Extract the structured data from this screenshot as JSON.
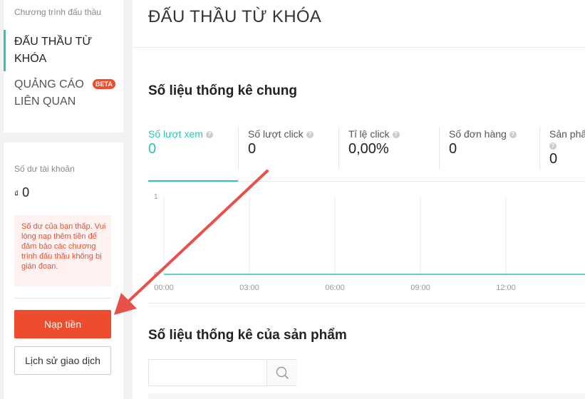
{
  "sidebar": {
    "section_label": "Chương trình đấu thầu",
    "items": [
      {
        "label": "ĐẤU THẦU TỪ KHÓA",
        "active": true
      },
      {
        "label": "QUẢNG CÁO LIÊN QUAN",
        "badge": "BETA"
      }
    ]
  },
  "balance": {
    "label": "Số dư tài khoản",
    "currency": "₫",
    "value": "0",
    "warning": "Số dư của bạn thấp. Vui lòng nạp thêm tiền để đảm bảo các chương trình đấu thầu không bị gián đoạn.",
    "topup_button": "Nạp tiền",
    "history_button": "Lịch sử giao dịch"
  },
  "main": {
    "page_title": "ĐẤU THẦU TỪ KHÓA",
    "stats_title": "Số liệu thống kê chung",
    "metrics": [
      {
        "label": "Số lượt xem",
        "value": "0",
        "active": true
      },
      {
        "label": "Số lượt click",
        "value": "0"
      },
      {
        "label": "Tỉ lệ click",
        "value": "0,00%"
      },
      {
        "label": "Số đơn hàng",
        "value": "0"
      },
      {
        "label": "Sản phẩ",
        "value": "0"
      }
    ],
    "product_stats_title": "Số liệu thống kê của sản phẩm",
    "search": {
      "placeholder": ""
    }
  },
  "colors": {
    "accent": "#2ec4b6",
    "primary_button": "#ee4d2d",
    "warning_bg": "#fff1f0",
    "annotation_arrow": "#e8504a"
  },
  "chart_data": {
    "type": "line",
    "x": [
      "00:00",
      "03:00",
      "06:00",
      "09:00",
      "12:00"
    ],
    "series": [
      {
        "values": [
          0,
          0,
          0,
          0,
          0
        ]
      }
    ],
    "y_ticks": [
      "1",
      "0"
    ],
    "ylim": [
      0,
      1
    ],
    "grid": true
  }
}
